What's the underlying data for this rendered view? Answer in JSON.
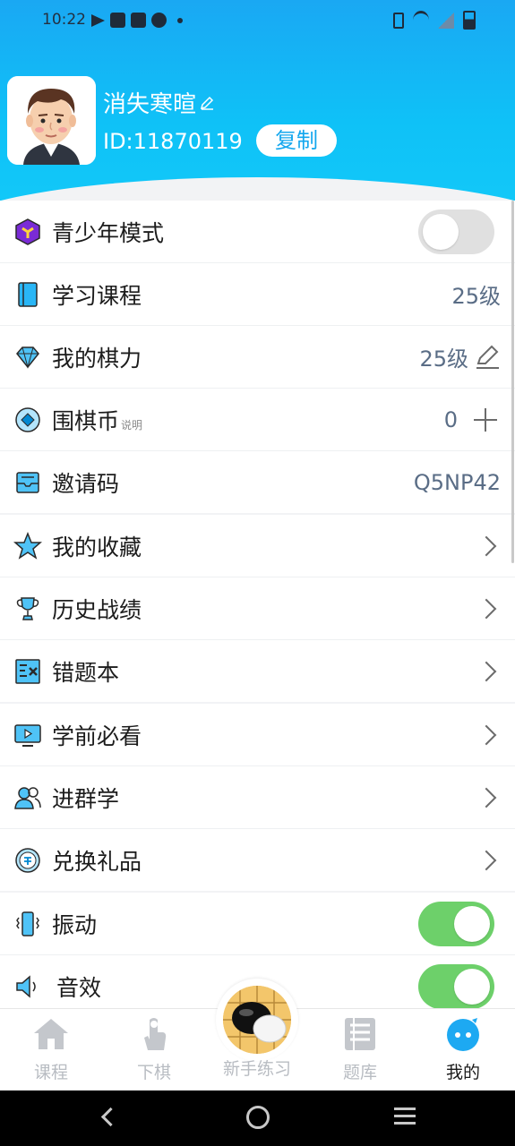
{
  "status_bar": {
    "time": "10:22"
  },
  "profile": {
    "username": "消失寒暄",
    "user_id": "ID:11870119",
    "copy_label": "复制"
  },
  "settings": {
    "section1": [
      {
        "label": "青少年模式",
        "icon": "youth-mode-icon",
        "control": "toggle",
        "on": false
      },
      {
        "label": "学习课程",
        "icon": "book-icon",
        "value": "25级"
      },
      {
        "label": "我的棋力",
        "icon": "diamond-icon",
        "value": "25级",
        "edit": true
      },
      {
        "label": "围棋币",
        "sub": "说明",
        "icon": "coin-icon",
        "value": "0",
        "add": true
      },
      {
        "label": "邀请码",
        "icon": "invite-icon",
        "value": "Q5NP42"
      }
    ],
    "section2": [
      {
        "label": "我的收藏",
        "icon": "star-icon"
      },
      {
        "label": "历史战绩",
        "icon": "trophy-icon"
      },
      {
        "label": "错题本",
        "icon": "error-book-icon"
      }
    ],
    "section3": [
      {
        "label": "学前必看",
        "icon": "video-icon"
      },
      {
        "label": "进群学",
        "icon": "group-icon"
      },
      {
        "label": "兑换礼品",
        "icon": "gift-exchange-icon"
      }
    ],
    "section4": [
      {
        "label": "振动",
        "icon": "vibrate-icon",
        "control": "toggle",
        "on": true
      },
      {
        "label": "音效",
        "icon": "speaker-icon",
        "control": "toggle",
        "on": true
      }
    ]
  },
  "tabs": [
    {
      "label": "课程",
      "icon": "home-icon",
      "active": false
    },
    {
      "label": "下棋",
      "icon": "tap-icon",
      "active": false
    },
    {
      "label": "新手练习",
      "icon": "go-stones-icon",
      "active": false
    },
    {
      "label": "题库",
      "icon": "question-bank-icon",
      "active": false
    },
    {
      "label": "我的",
      "icon": "mascot-icon",
      "active": true
    }
  ],
  "colors": {
    "header": "#12b8f5",
    "toggle_on": "#6dd06a",
    "value_text": "#5a6d86",
    "accent": "#14a7ee"
  }
}
